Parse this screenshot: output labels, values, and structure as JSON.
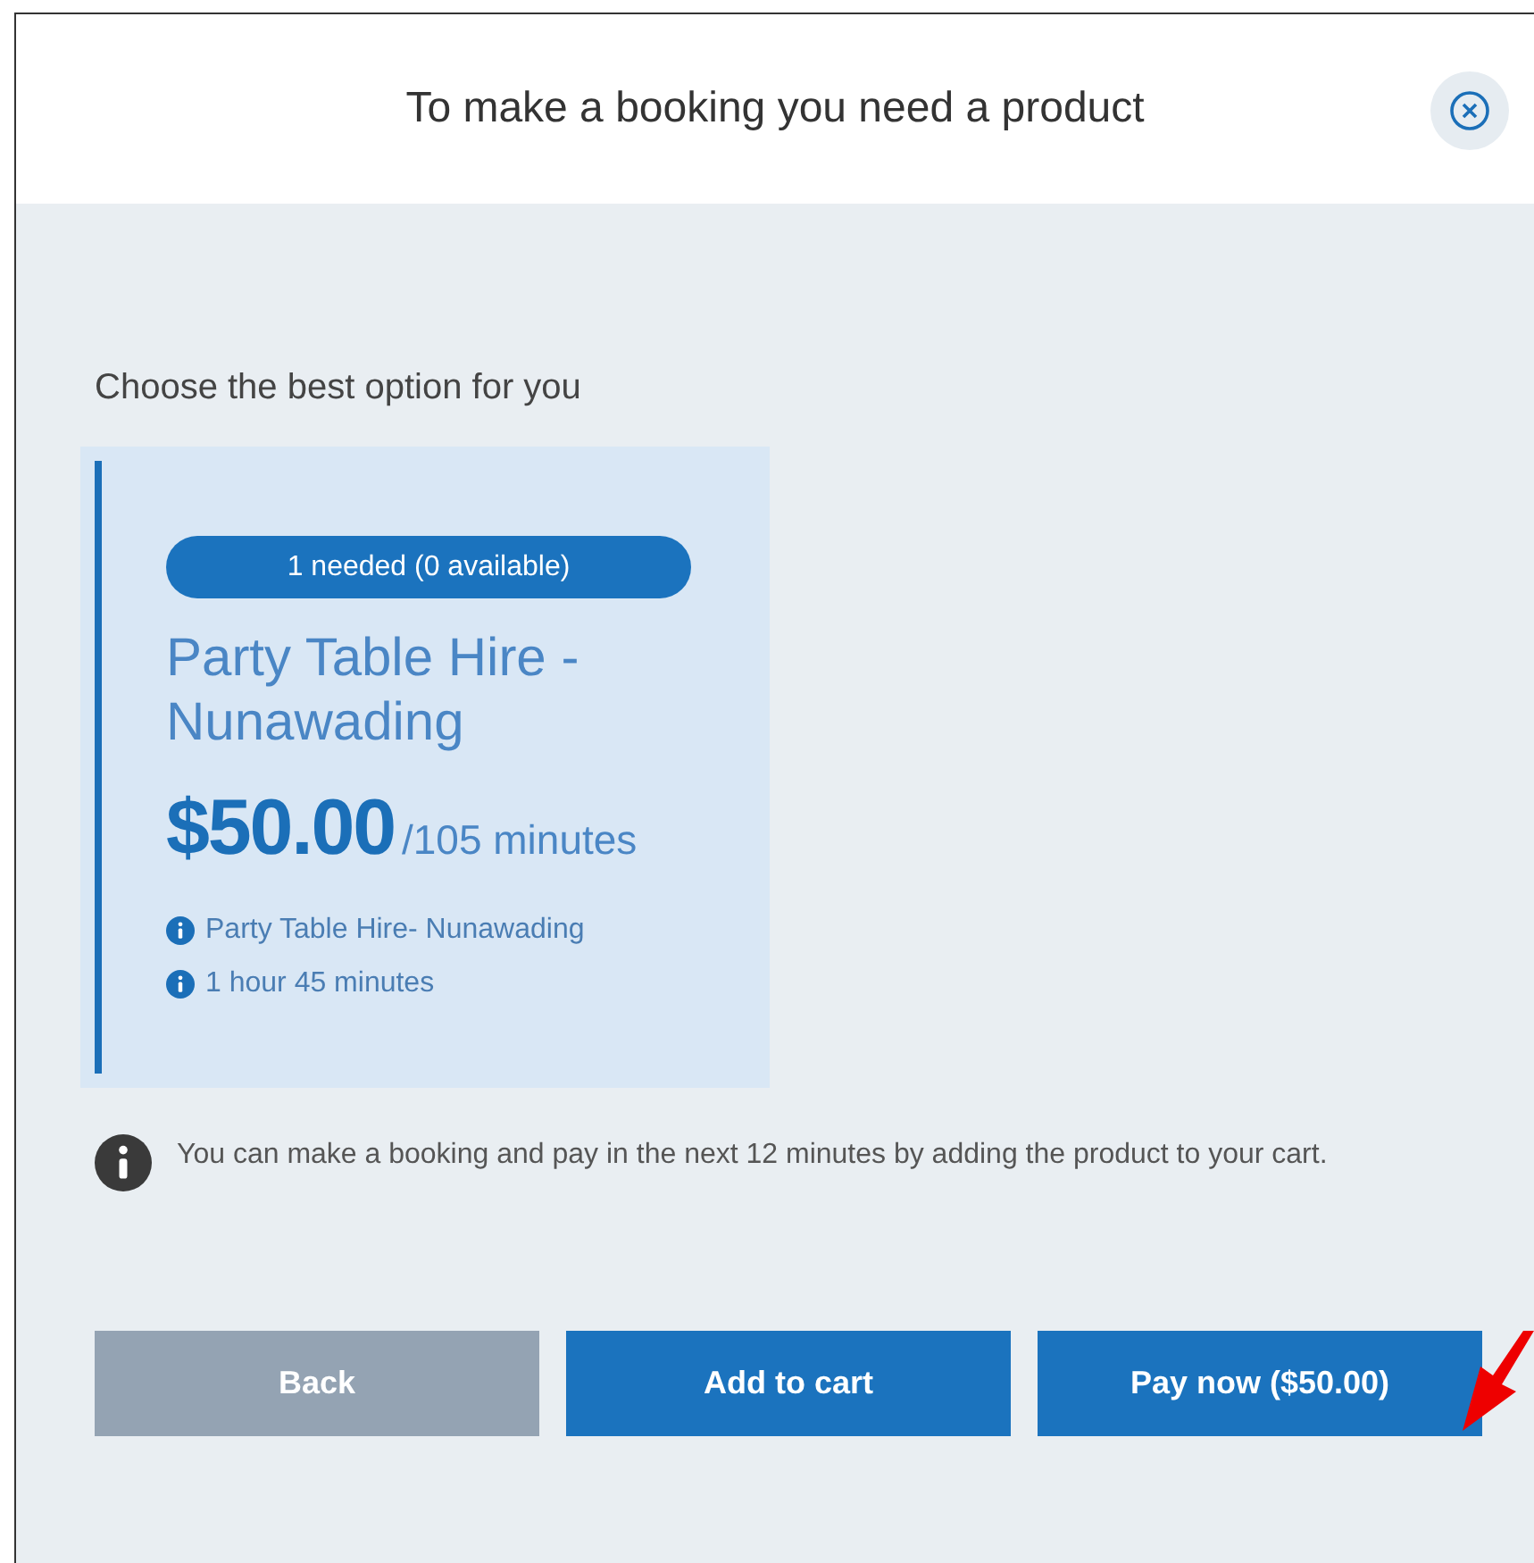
{
  "dialog": {
    "title": "To make a booking you need a product"
  },
  "prompt": "Choose the best option for you",
  "product": {
    "badge": "1 needed (0 available)",
    "name": "Party Table Hire - Nunawading",
    "price": "$50.00",
    "duration": "/105 minutes",
    "details": [
      "Party Table Hire- Nunawading",
      "1 hour 45 minutes"
    ]
  },
  "notice": "You can make a booking and pay in the next 12 minutes by adding the product to your cart.",
  "buttons": [
    {
      "label": "Back",
      "kind": "secondary"
    },
    {
      "label": "Add to cart",
      "kind": "primary"
    },
    {
      "label": "Pay now ($50.00)",
      "kind": "primary"
    }
  ]
}
